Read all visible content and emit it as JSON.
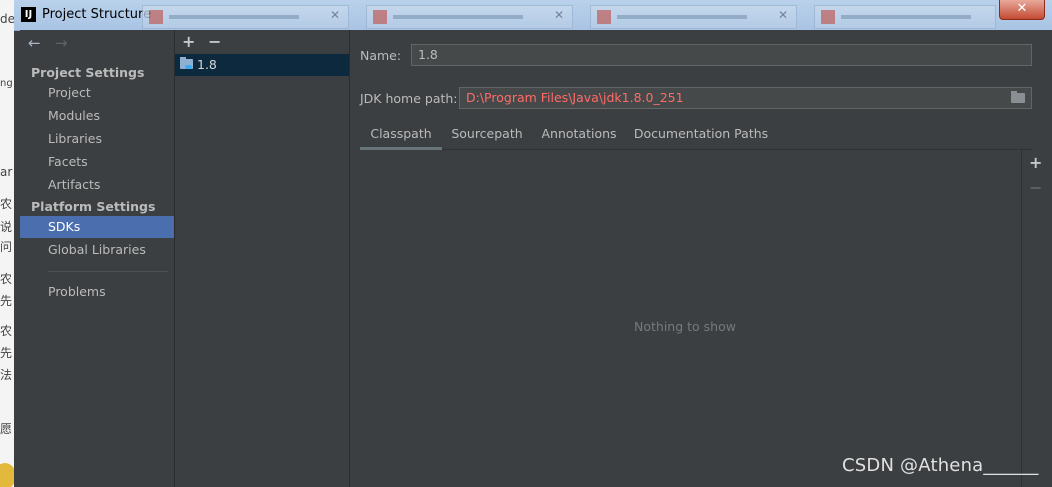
{
  "window": {
    "title": "Project Structure",
    "app_icon_text": "IJ",
    "close_glyph": "✕"
  },
  "background_app": {
    "edge_chars": [
      "de",
      "ng",
      "ar",
      "农",
      "说",
      "问",
      "农",
      "先",
      "农",
      "先",
      "法",
      "愿"
    ]
  },
  "nav": {
    "back_glyph": "←",
    "forward_glyph": "→"
  },
  "project_settings": {
    "title": "Project Settings",
    "items": [
      "Project",
      "Modules",
      "Libraries",
      "Facets",
      "Artifacts"
    ]
  },
  "platform_settings": {
    "title": "Platform Settings",
    "items": [
      "SDKs",
      "Global Libraries"
    ],
    "selected": "SDKs"
  },
  "problems": {
    "label": "Problems"
  },
  "sdk_list": {
    "add_glyph": "+",
    "remove_glyph": "−",
    "items": [
      {
        "label": "1.8",
        "icon": "folder-icon"
      }
    ]
  },
  "details": {
    "name_label": "Name:",
    "name_value": "1.8",
    "jdk_label": "JDK home path:",
    "jdk_value": "D:\\Program Files\\Java\\jdk1.8.0_251",
    "tabs": [
      "Classpath",
      "Sourcepath",
      "Annotations",
      "Documentation Paths"
    ],
    "active_tab": "Classpath",
    "empty_text": "Nothing to show",
    "side_add_glyph": "+",
    "side_remove_glyph": "−"
  },
  "watermark": "CSDN @Athena______",
  "colors": {
    "panel_bg": "#3c3f41",
    "selection": "#4b6eaf",
    "sdk_selection": "#0d293e",
    "error_path": "#ff6b68"
  }
}
